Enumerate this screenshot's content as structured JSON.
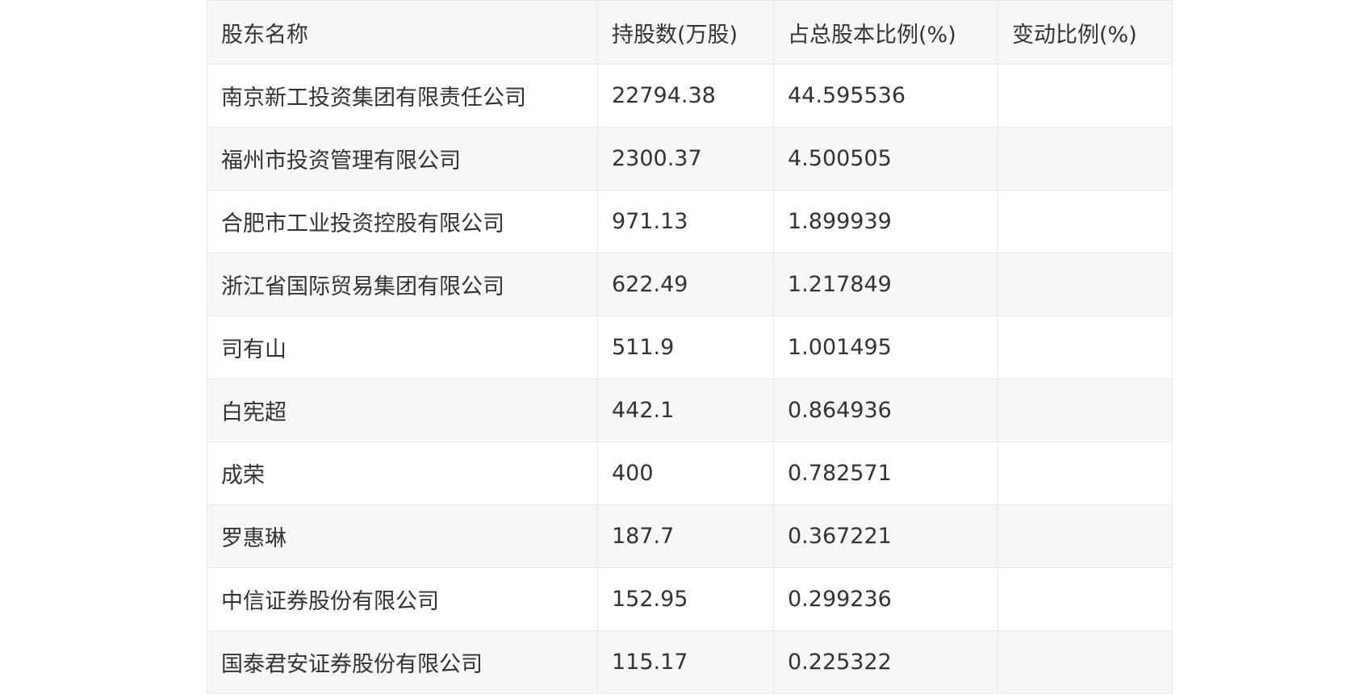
{
  "table": {
    "headers": [
      "股东名称",
      "持股数(万股)",
      "占总股本比例(%)",
      "变动比例(%)"
    ],
    "rows": [
      [
        "南京新工投资集团有限责任公司",
        "22794.38",
        "44.595536",
        ""
      ],
      [
        "福州市投资管理有限公司",
        "2300.37",
        "4.500505",
        ""
      ],
      [
        "合肥市工业投资控股有限公司",
        "971.13",
        "1.899939",
        ""
      ],
      [
        "浙江省国际贸易集团有限公司",
        "622.49",
        "1.217849",
        ""
      ],
      [
        "司有山",
        "511.9",
        "1.001495",
        ""
      ],
      [
        "白宪超",
        "442.1",
        "0.864936",
        ""
      ],
      [
        "成荣",
        "400",
        "0.782571",
        ""
      ],
      [
        "罗惠琳",
        "187.7",
        "0.367221",
        ""
      ],
      [
        "中信证券股份有限公司",
        "152.95",
        "0.299236",
        ""
      ],
      [
        "国泰君安证券股份有限公司",
        "115.17",
        "0.225322",
        ""
      ]
    ]
  }
}
